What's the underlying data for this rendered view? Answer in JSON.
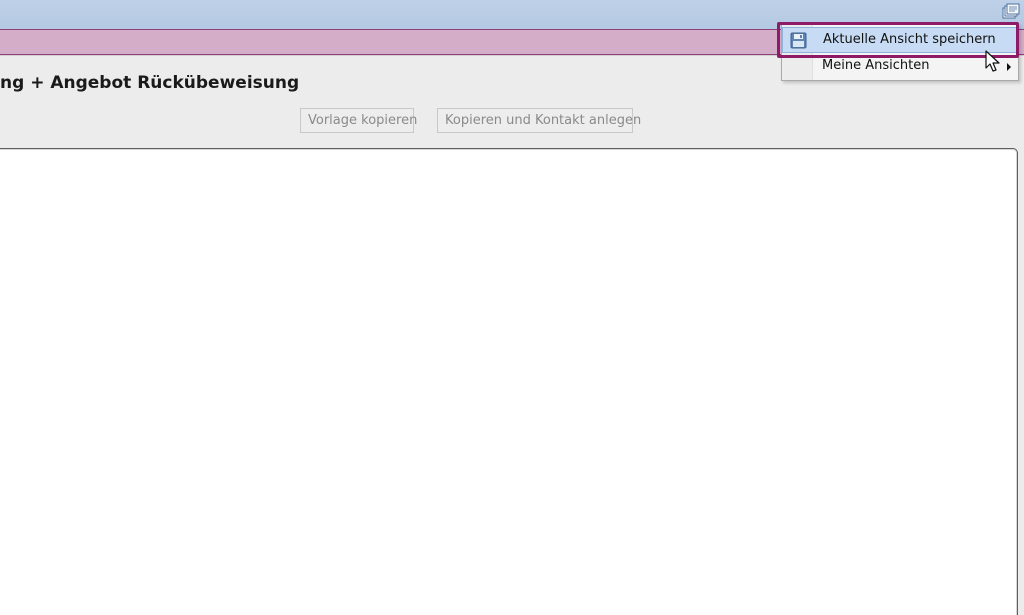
{
  "toolbar": {
    "views_icon": "views-stack-icon"
  },
  "page": {
    "title": "ng + Angebot Rückübeweisung"
  },
  "actions": {
    "copy_template_label": "Vorlage kopieren",
    "copy_and_create_contact_label": "Kopieren und Kontakt anlegen"
  },
  "views_menu": {
    "save_current_view_label": "Aktuelle Ansicht speichern",
    "my_views_label": "Meine Ansichten",
    "save_icon": "save-disk-icon",
    "submenu_icon": "chevron-right-icon"
  },
  "colors": {
    "accent": "#8e1b67",
    "pink_bar": "#d4adc9",
    "top_strip": "#bfd1e8",
    "menu_highlight": "#c7dcf4"
  }
}
